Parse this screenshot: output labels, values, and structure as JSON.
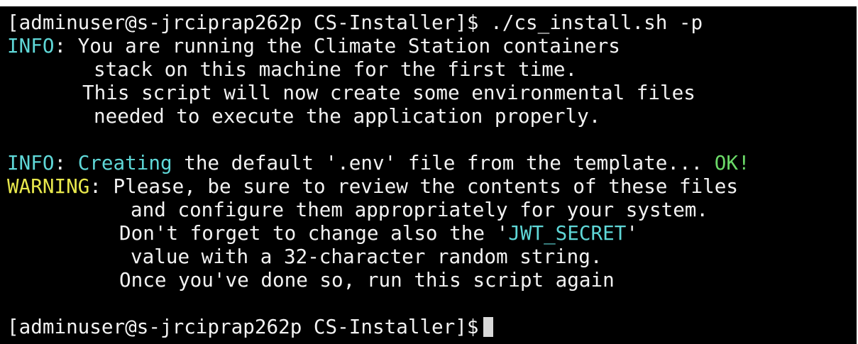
{
  "window": {
    "background": "#000000"
  },
  "colors": {
    "text": "#f2f2f2",
    "info": "#5fd7d7",
    "ok": "#6bd968",
    "warning": "#e8e84c"
  },
  "terminal": {
    "command_prompt": "[adminuser@s-jrciprap262p CS-Installer]$",
    "command": " ./cs_install.sh -p",
    "info1": {
      "label": "INFO",
      "line1": ": You are running the Climate Station containers",
      "line2": "stack on this machine for the first time.",
      "line3": "This script will now create some environmental files",
      "line4": "needed to execute the application properly."
    },
    "info2": {
      "label": "INFO",
      "colon": ": ",
      "keyword": "Creating",
      "text": " the default '.env' file from the template... ",
      "status": "OK!"
    },
    "warning": {
      "label": "WARNING",
      "line1": ": Please, be sure to review the contents of these files",
      "line2": "and configure them appropriately for your system.",
      "line3_before": "Don't forget to change also the '",
      "line3_key": "JWT_SECRET",
      "line3_after": "'",
      "line4": "value with a 32-character random string.",
      "line5": "Once you've done so, run this script again"
    },
    "final_prompt": "[adminuser@s-jrciprap262p CS-Installer]$"
  }
}
